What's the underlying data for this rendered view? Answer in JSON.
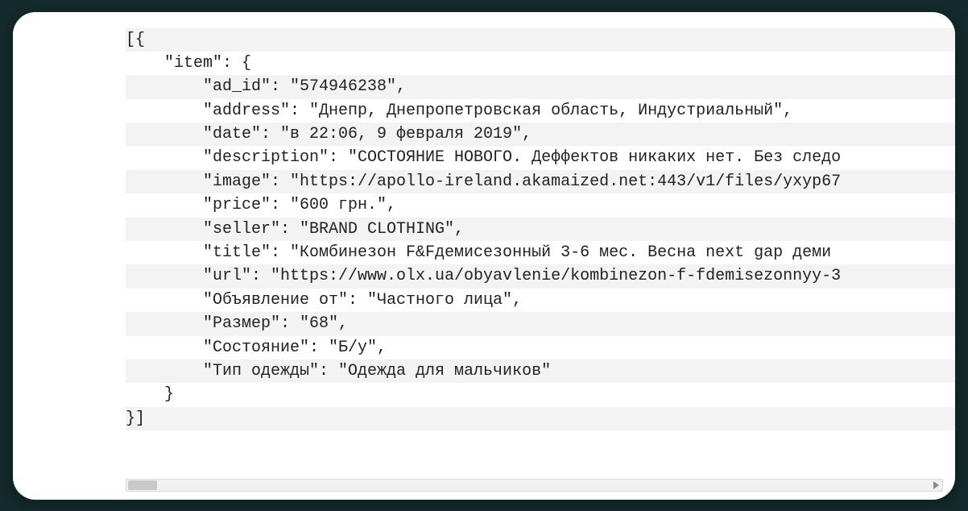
{
  "code": {
    "lines": [
      {
        "indent": 0,
        "text": "[{"
      },
      {
        "indent": 1,
        "text": "\"item\": {"
      },
      {
        "indent": 2,
        "text": "\"ad_id\": \"574946238\","
      },
      {
        "indent": 2,
        "text": "\"address\": \"Днепр, Днепропетровская область, Индустриальный\","
      },
      {
        "indent": 2,
        "text": "\"date\": \"в 22:06, 9 февраля 2019\","
      },
      {
        "indent": 2,
        "text": "\"description\": \"СОСТОЯНИЕ НОВОГО. Деффектов никаких нет. Без следо"
      },
      {
        "indent": 2,
        "text": "\"image\": \"https://apollo-ireland.akamaized.net:443/v1/files/yxyp67"
      },
      {
        "indent": 2,
        "text": "\"price\": \"600 грн.\","
      },
      {
        "indent": 2,
        "text": "\"seller\": \"BRAND CLOTHING\","
      },
      {
        "indent": 2,
        "text": "\"title\": \"Комбинезон F&Fдемисезонный 3-6 мес. Весна next gap деми"
      },
      {
        "indent": 2,
        "text": "\"url\": \"https://www.olx.ua/obyavlenie/kombinezon-f-fdemisezonnyy-3"
      },
      {
        "indent": 2,
        "text": "\"Объявление от\": \"Частного лица\","
      },
      {
        "indent": 2,
        "text": "\"Размер\": \"68\","
      },
      {
        "indent": 2,
        "text": "\"Состояние\": \"Б/у\","
      },
      {
        "indent": 2,
        "text": "\"Тип одежды\": \"Одежда для мальчиков\""
      },
      {
        "indent": 1,
        "text": "}"
      },
      {
        "indent": 0,
        "text": "}]"
      }
    ]
  },
  "parsed_item": {
    "ad_id": "574946238",
    "address": "Днепр, Днепропетровская область, Индустриальный",
    "date": "в 22:06, 9 февраля 2019",
    "description": "СОСТОЯНИЕ НОВОГО. Деффектов никаких нет. Без следо",
    "image": "https://apollo-ireland.akamaized.net:443/v1/files/yxyp67",
    "price": "600 грн.",
    "seller": "BRAND CLOTHING",
    "title": "Комбинезон F&Fдемисезонный 3-6 мес. Весна next gap деми",
    "url": "https://www.olx.ua/obyavlenie/kombinezon-f-fdemisezonnyy-3",
    "Объявление от": "Частного лица",
    "Размер": "68",
    "Состояние": "Б/у",
    "Тип одежды": "Одежда для мальчиков"
  }
}
